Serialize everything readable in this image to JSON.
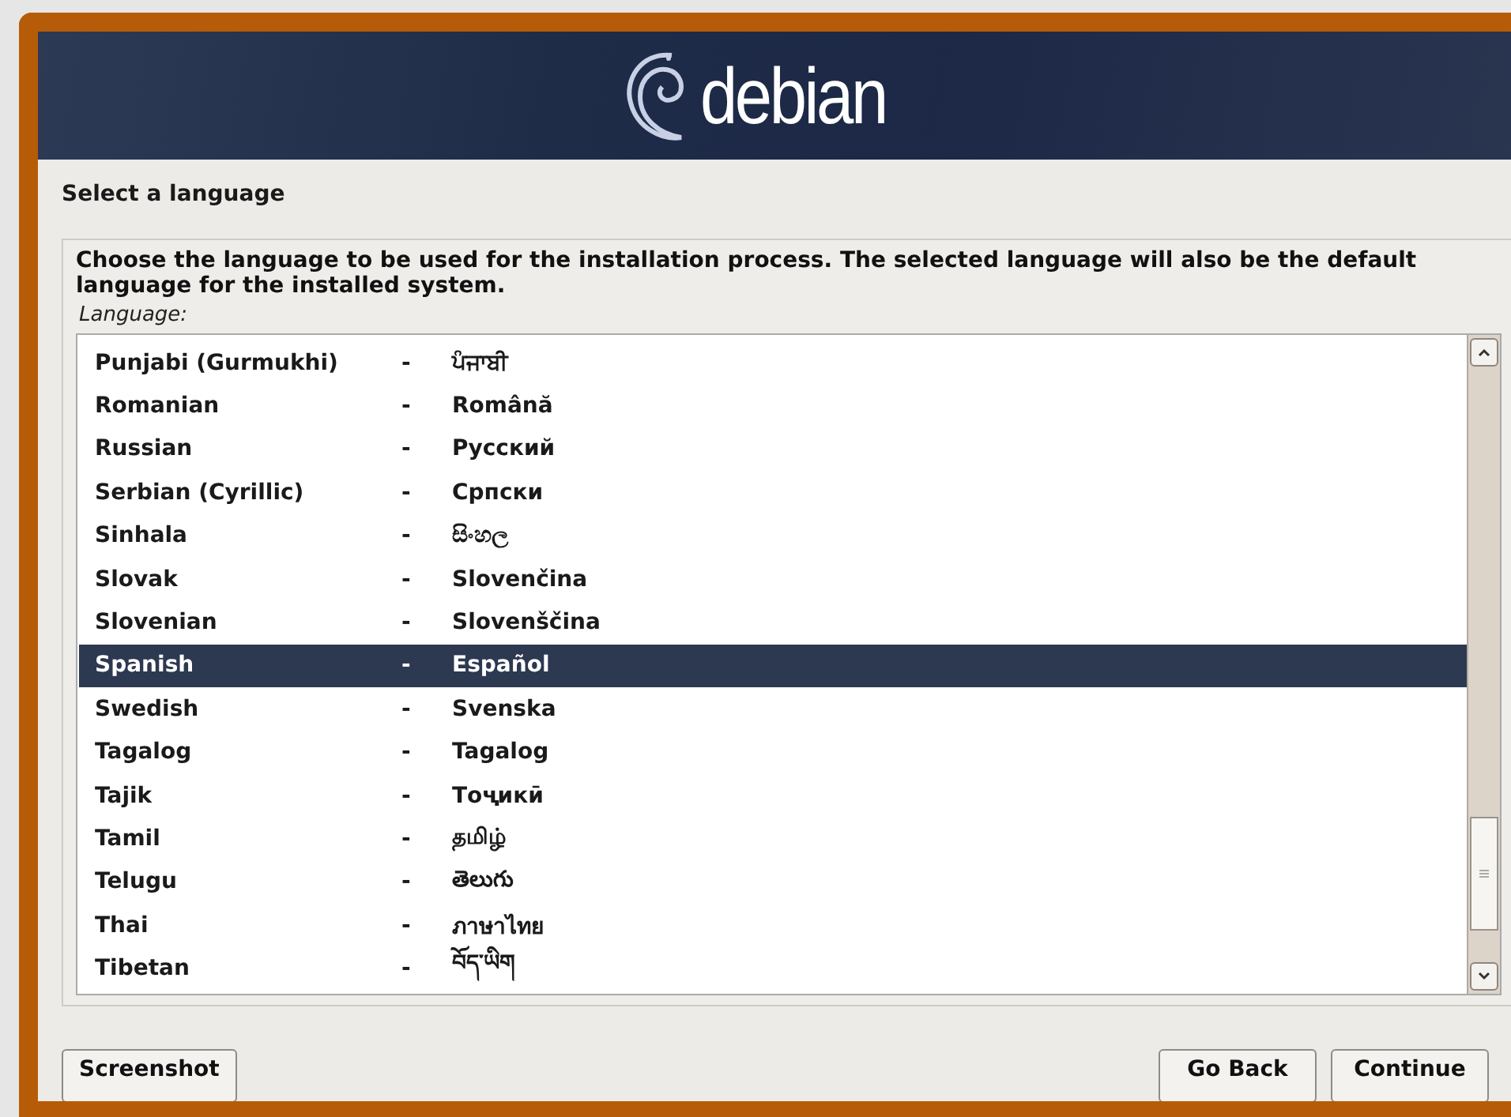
{
  "header": {
    "logo_text": "debian"
  },
  "step_title": "Select a language",
  "description": "Choose the language to be used for the installation process. The selected language will also be the default language for the installed system.",
  "list_label": "Language:",
  "languages": [
    {
      "name": "Punjabi (Gurmukhi)",
      "separator": "-",
      "native": "ਪੰਜਾਬੀ",
      "selected": false
    },
    {
      "name": "Romanian",
      "separator": "-",
      "native": "Română",
      "selected": false
    },
    {
      "name": "Russian",
      "separator": "-",
      "native": "Русский",
      "selected": false
    },
    {
      "name": "Serbian (Cyrillic)",
      "separator": "-",
      "native": "Српски",
      "selected": false
    },
    {
      "name": "Sinhala",
      "separator": "-",
      "native": "සිංහල",
      "selected": false
    },
    {
      "name": "Slovak",
      "separator": "-",
      "native": "Slovenčina",
      "selected": false
    },
    {
      "name": "Slovenian",
      "separator": "-",
      "native": "Slovenščina",
      "selected": false
    },
    {
      "name": "Spanish",
      "separator": "-",
      "native": "Español",
      "selected": true
    },
    {
      "name": "Swedish",
      "separator": "-",
      "native": "Svenska",
      "selected": false
    },
    {
      "name": "Tagalog",
      "separator": "-",
      "native": "Tagalog",
      "selected": false
    },
    {
      "name": "Tajik",
      "separator": "-",
      "native": "Тоҷикӣ",
      "selected": false
    },
    {
      "name": "Tamil",
      "separator": "-",
      "native": "தமிழ்",
      "selected": false
    },
    {
      "name": "Telugu",
      "separator": "-",
      "native": "తెలుగు",
      "selected": false
    },
    {
      "name": "Thai",
      "separator": "-",
      "native": "ภาษาไทย",
      "selected": false
    },
    {
      "name": "Tibetan",
      "separator": "-",
      "native": "བོད་ཡིག",
      "selected": false
    }
  ],
  "buttons_left": [
    "Screenshot"
  ],
  "buttons_right": [
    "Go Back",
    "Continue"
  ]
}
